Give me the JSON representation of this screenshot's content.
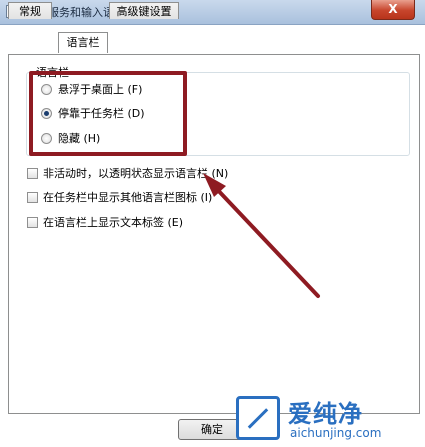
{
  "window": {
    "title": "文本服务和输入语言",
    "close_label": "X"
  },
  "tabs": [
    {
      "label": "常规",
      "active": false
    },
    {
      "label": "语言栏",
      "active": true
    },
    {
      "label": "高级键设置",
      "active": false
    }
  ],
  "language_bar_group": {
    "legend": "语言栏",
    "options": [
      {
        "label": "悬浮于桌面上 (F)",
        "checked": false
      },
      {
        "label": "停靠于任务栏 (D)",
        "checked": true
      },
      {
        "label": "隐藏 (H)",
        "checked": false
      }
    ]
  },
  "checkboxes": [
    {
      "label": "非活动时，以透明状态显示语言栏 (N)",
      "checked": false
    },
    {
      "label": "在任务栏中显示其他语言栏图标 (I)",
      "checked": false
    },
    {
      "label": "在语言栏上显示文本标签 (E)",
      "checked": false
    }
  ],
  "buttons": {
    "ok": "确定"
  },
  "watermark": {
    "title": "爱纯净",
    "url": "aichunjing.com"
  },
  "colors": {
    "annotation": "#8e1b22",
    "watermark": "#2a6fc0"
  }
}
